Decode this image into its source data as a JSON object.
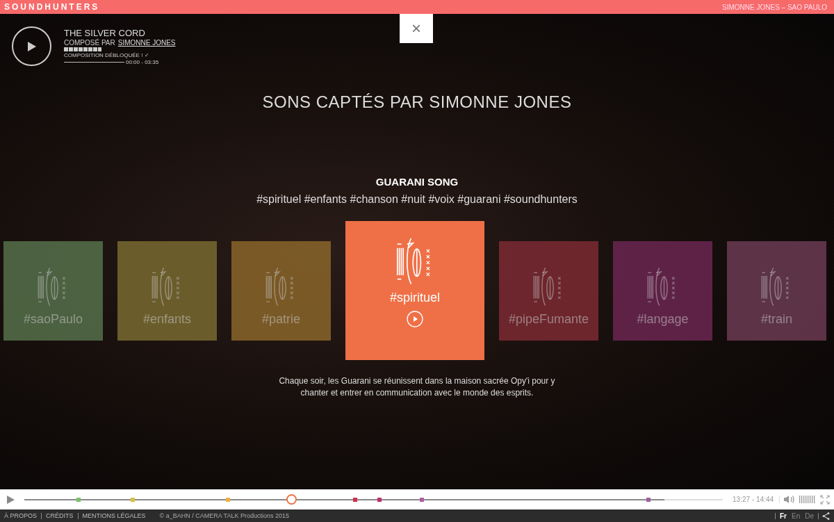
{
  "top_bar": {
    "logo": "SOUNDHUNTERS",
    "location": "SIMONNE JONES – SAO PAULO"
  },
  "player": {
    "title": "THE SILVER CORD",
    "composer_prefix": "COMPOSÉ PAR",
    "composer": "SIMONNE JONES",
    "status": "COMPOSITION DÉBLOQUÉE ! ✓",
    "time": "00:00 - 03:35"
  },
  "close": "×",
  "heading": "SONS CAPTÉS PAR SIMONNE JONES",
  "song": {
    "title": "GUARANI SONG",
    "tags": "#spirituel #enfants #chanson #nuit #voix #guarani #soundhunters",
    "description": "Chaque soir, les Guarani se réunissent dans la maison sacrée Opy'i pour y chanter et entrer en communication avec le monde des esprits."
  },
  "tiles": [
    {
      "label": "#saoPaulo",
      "color": "#55704a",
      "selected": false
    },
    {
      "label": "#enfants",
      "color": "#786a30",
      "selected": false
    },
    {
      "label": "#patrie",
      "color": "#89652a",
      "selected": false
    },
    {
      "label": "#spirituel",
      "color": "#ef7047",
      "selected": true
    },
    {
      "label": "#pipeFumante",
      "color": "#7b2a32",
      "selected": false
    },
    {
      "label": "#langage",
      "color": "#6c2652",
      "selected": false
    },
    {
      "label": "#train",
      "color": "#6b3a52",
      "selected": false
    }
  ],
  "timeline": {
    "level": 0.916,
    "time": "13:27 - 14:44",
    "markers": [
      {
        "level": 0.078,
        "color": "#7dbf6a",
        "selected": false
      },
      {
        "level": 0.155,
        "color": "#d9c040",
        "selected": false
      },
      {
        "level": 0.292,
        "color": "#f0b040",
        "selected": false
      },
      {
        "level": 0.382,
        "color": "#f07040",
        "selected": true
      },
      {
        "level": 0.474,
        "color": "#d0304a",
        "selected": false
      },
      {
        "level": 0.508,
        "color": "#c03070",
        "selected": false
      },
      {
        "level": 0.569,
        "color": "#b060a0",
        "selected": false
      },
      {
        "level": 0.893,
        "color": "#a060a0",
        "selected": false
      }
    ]
  },
  "footer": {
    "links": [
      "À PROPOS",
      "CRÉDITS",
      "MENTIONS LÉGALES"
    ],
    "copyright": "© a_BAHN / CAMERA TALK Productions 2015",
    "languages": [
      {
        "label": "Fr",
        "selected": true
      },
      {
        "label": "En",
        "selected": false
      },
      {
        "label": "De",
        "selected": false
      }
    ]
  }
}
